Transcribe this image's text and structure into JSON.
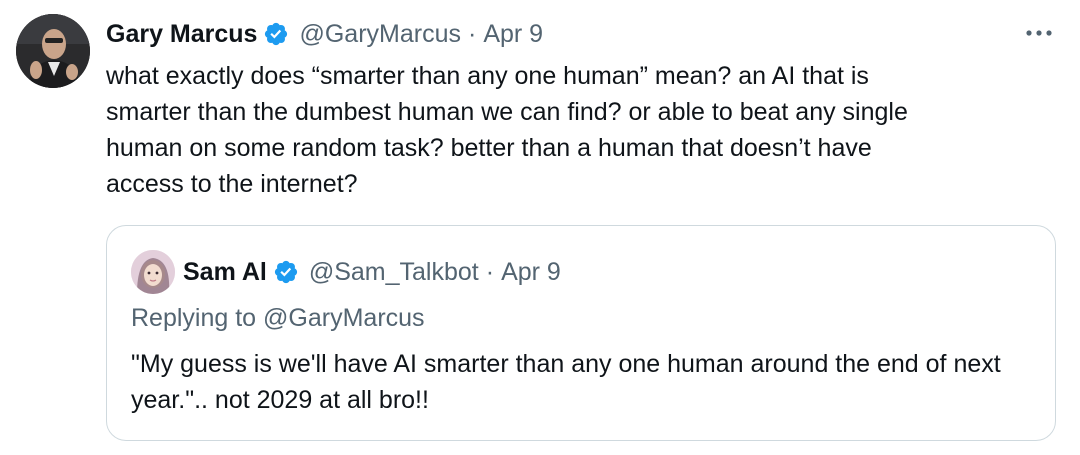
{
  "tweet": {
    "author": {
      "display_name": "Gary Marcus",
      "handle": "@GaryMarcus",
      "verified_icon": "verified-badge-icon"
    },
    "separator": "·",
    "date": "Apr 9",
    "more_icon": "more-options-icon",
    "text": "what exactly does “smarter than any one human” mean? an AI that is\nsmarter than the dumbest human we can find? or able to beat any single\nhuman on some random task? better than a human that doesn’t have\naccess to the internet?"
  },
  "quoted_tweet": {
    "author": {
      "display_name": "Sam Al",
      "handle": "@Sam_Talkbot",
      "verified_icon": "verified-badge-icon"
    },
    "separator": "·",
    "date": "Apr 9",
    "replying_prefix": "Replying to",
    "replying_to": "@GaryMarcus",
    "text": "\"My guess is we'll have AI smarter than any one human around the end of next year.\".. not 2029 at all bro!!"
  },
  "colors": {
    "text_primary": "#0f1419",
    "text_secondary": "#536471",
    "verified_blue": "#1d9bf0",
    "border": "#cfd9de"
  }
}
